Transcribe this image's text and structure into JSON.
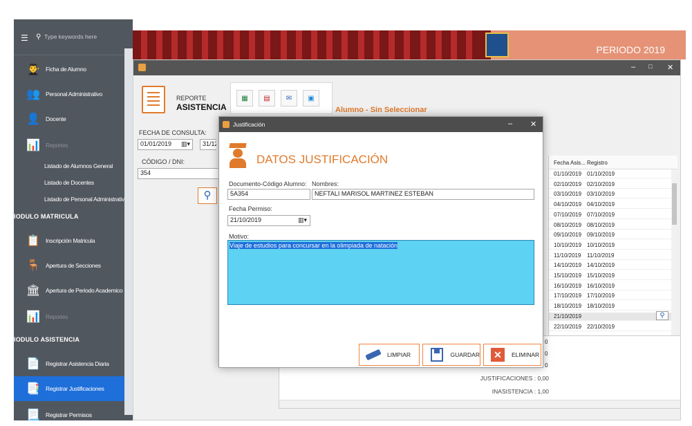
{
  "sidebar": {
    "search_placeholder": "Type keywords here",
    "items": [
      {
        "label": "Ficha de Alumno",
        "icon": "student-icon"
      },
      {
        "label": "Personal Administrativo",
        "icon": "staff-icon"
      },
      {
        "label": "Docente",
        "icon": "teacher-icon"
      },
      {
        "label": "Reportes",
        "icon": "reports-icon"
      }
    ],
    "report_subitems": [
      "Listado de Alumnos General",
      "Listado de Docentes",
      "Listado de Personal Administrativo"
    ],
    "section_matricula": "IODULO MATRICULA",
    "matricula_items": [
      {
        "label": "Inscripción Matricula",
        "icon": "enrollment-icon"
      },
      {
        "label": "Apertura de Secciones",
        "icon": "sections-icon"
      },
      {
        "label": "Apertura de Periodo Academico",
        "icon": "academic-period-icon"
      },
      {
        "label": "Reportes",
        "icon": "reports-icon"
      }
    ],
    "section_asistencia": "IODULO ASISTENCIA",
    "asistencia_items": [
      {
        "label": "Registrar Asistencia Diaria",
        "icon": "attendance-icon"
      },
      {
        "label": "Registrar Justificaciones",
        "icon": "justification-icon"
      },
      {
        "label": "Registrar Permisos",
        "icon": "permissions-icon"
      }
    ]
  },
  "banner": {
    "periodo": "PERIODO 2019"
  },
  "main": {
    "report_title_1": "REPORTE",
    "report_title_2": "ASISTENCIA",
    "alumno_status": "Alumno - Sin Seleccionar",
    "fecha_consulta_label": "FECHA DE CONSULTA:",
    "fecha_desde": "01/01/2019",
    "fecha_hasta": "31/12/",
    "codigo_label": "CÓDIGO / DNI:",
    "codigo_value": "354",
    "grid": {
      "headers": [
        "Fecha Asis...",
        "Registro"
      ],
      "rows": [
        [
          "01/10/2019",
          "01/10/2019"
        ],
        [
          "02/10/2019",
          "02/10/2019"
        ],
        [
          "03/10/2019",
          "03/10/2019"
        ],
        [
          "04/10/2019",
          "04/10/2019"
        ],
        [
          "07/10/2019",
          "07/10/2019"
        ],
        [
          "08/10/2019",
          "08/10/2019"
        ],
        [
          "09/10/2019",
          "09/10/2019"
        ],
        [
          "10/10/2019",
          "10/10/2019"
        ],
        [
          "11/10/2019",
          "11/10/2019"
        ],
        [
          "14/10/2019",
          "14/10/2019"
        ],
        [
          "15/10/2019",
          "15/10/2019"
        ],
        [
          "16/10/2019",
          "16/10/2019"
        ],
        [
          "17/10/2019",
          "17/10/2019"
        ],
        [
          "18/10/2019",
          "18/10/2019"
        ],
        [
          "21/10/2019",
          ""
        ],
        [
          "22/10/2019",
          "22/10/2019"
        ]
      ]
    },
    "totals_partial": [
      "0",
      "0",
      "0"
    ],
    "justificaciones": "JUSTIFICACIONES : 0,00",
    "inasistencia": "INASISTENCIA : 1,00"
  },
  "dialog": {
    "title": "Justificación",
    "heading": "DATOS JUSTIFICACIÓN",
    "doc_label": "Documento-Código Alumno:",
    "doc_value": "5A354",
    "nombres_label": "Nombres:",
    "nombres_value": "NEFTALI MARISOL MARTINEZ ESTEBAN",
    "fecha_permiso_label": "Fecha Permiso:",
    "fecha_permiso_value": "21/10/2019",
    "motivo_label": "Motivo:",
    "motivo_value": "Viaje de estudios para concursar en la olimpiada de natación",
    "btn_limpiar": "LIMPIAR",
    "btn_guardar": "GUARDAR",
    "btn_eliminar": "ELIMINAR"
  },
  "colors": {
    "accent": "#e07a2c",
    "sidebar": "#51575f",
    "active": "#1e6fd9",
    "motivo_bg": "#5ed2f2",
    "alumno_status": "#e07a2c"
  }
}
